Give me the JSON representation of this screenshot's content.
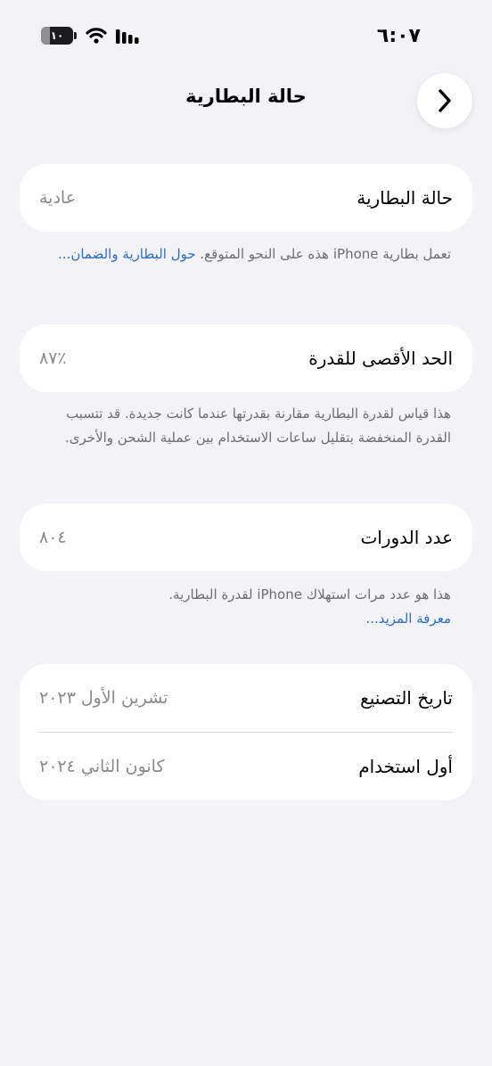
{
  "status_bar": {
    "time": "٦:٠٧",
    "battery_level": "١٠"
  },
  "nav": {
    "title": "حالة البطارية"
  },
  "battery_health": {
    "label": "حالة البطارية",
    "value": "عادية",
    "note_text": "تعمل بطارية iPhone هذه على النحو المتوقع. ",
    "note_link": "حول البطارية والضمان..."
  },
  "max_capacity": {
    "label": "الحد الأقصى للقدرة",
    "value": "٪٨٧",
    "note_text": "هذا قياس لقدرة البطارية مقارنة بقدرتها عندما كانت جديدة. قد تتسبب القدرة المنخفضة بتقليل ساعات الاستخدام بين عملية الشحن والأخرى."
  },
  "cycle_count": {
    "label": "عدد الدورات",
    "value": "٨٠٤",
    "note_text": "هذا هو عدد مرات استهلاك iPhone لقدرة البطارية.",
    "note_link": "معرفة المزيد..."
  },
  "dates": {
    "manufacture_label": "تاريخ التصنيع",
    "manufacture_value": "تشرين الأول ٢٠٢٣",
    "first_use_label": "أول استخدام",
    "first_use_value": "كانون الثاني ٢٠٢٤"
  },
  "icons": [
    "battery-icon",
    "wifi-icon",
    "cellular-signal-icon",
    "chevron-right-icon"
  ]
}
